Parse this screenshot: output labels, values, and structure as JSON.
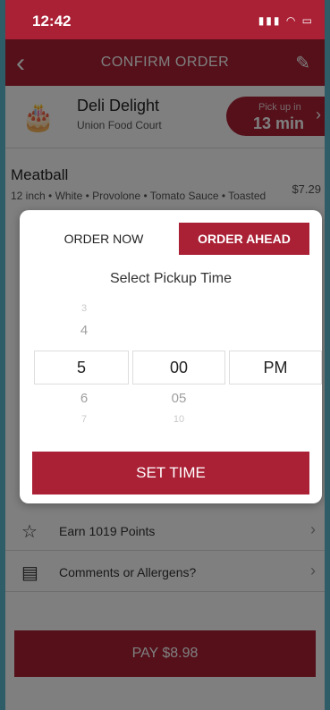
{
  "status_bar": {
    "time": "12:42",
    "icons": "signal wifi battery"
  },
  "navbar": {
    "title": "CONFIRM ORDER"
  },
  "store": {
    "name": "Deli Delight",
    "location": "Union Food Court",
    "pickup_label": "Pick up in",
    "pickup_time": "13 min"
  },
  "item": {
    "name": "Meatball",
    "desc": "12 inch • White • Provolone • Tomato Sauce • Toasted",
    "price": "$7.29"
  },
  "rows": [
    {
      "label": "Earn 1019 Points"
    },
    {
      "label": "Comments or Allergens?"
    }
  ],
  "pay": {
    "label": "PAY $8.98"
  },
  "modal": {
    "tab_now": "ORDER NOW",
    "tab_ahead": "ORDER AHEAD",
    "title": "Select Pickup Time",
    "hour": {
      "above": [
        "3",
        "4"
      ],
      "selected": "5",
      "below": [
        "6",
        "7"
      ]
    },
    "minute": {
      "selected": "00",
      "below": [
        "05",
        "10"
      ]
    },
    "ampm": {
      "selected": "PM"
    },
    "set_button": "SET TIME"
  },
  "icons": {
    "back": "chevron-left-icon",
    "edit": "pencil-icon",
    "store": "cake-icon",
    "points": "star-icon",
    "comments": "document-icon",
    "arrow": "chevron-right-icon"
  },
  "colors": {
    "brand": "#aa2035"
  }
}
